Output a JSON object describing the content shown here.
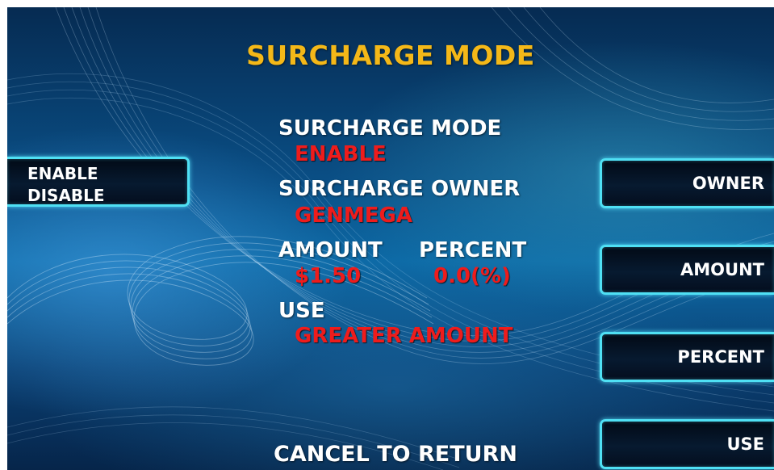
{
  "screen": {
    "title": "SURCHARGE MODE",
    "footer": "CANCEL TO RETURN"
  },
  "settings": {
    "mode_label": "SURCHARGE MODE",
    "mode_value": "ENABLE",
    "owner_label": "SURCHARGE OWNER",
    "owner_value": "GENMEGA",
    "amount_label": "AMOUNT",
    "amount_value": "$1.50",
    "percent_label": "PERCENT",
    "percent_value": "0.0(%)",
    "use_label": "USE",
    "use_value": "GREATER AMOUNT"
  },
  "buttons": {
    "left": {
      "line1": "ENABLE",
      "line2": "DISABLE"
    },
    "owner": "OWNER",
    "amount": "AMOUNT",
    "percent": "PERCENT",
    "use": "USE"
  },
  "colors": {
    "title": "#f4b818",
    "label": "#ffffff",
    "value": "#ee1c1c",
    "button_border": "#4fe0f4"
  }
}
